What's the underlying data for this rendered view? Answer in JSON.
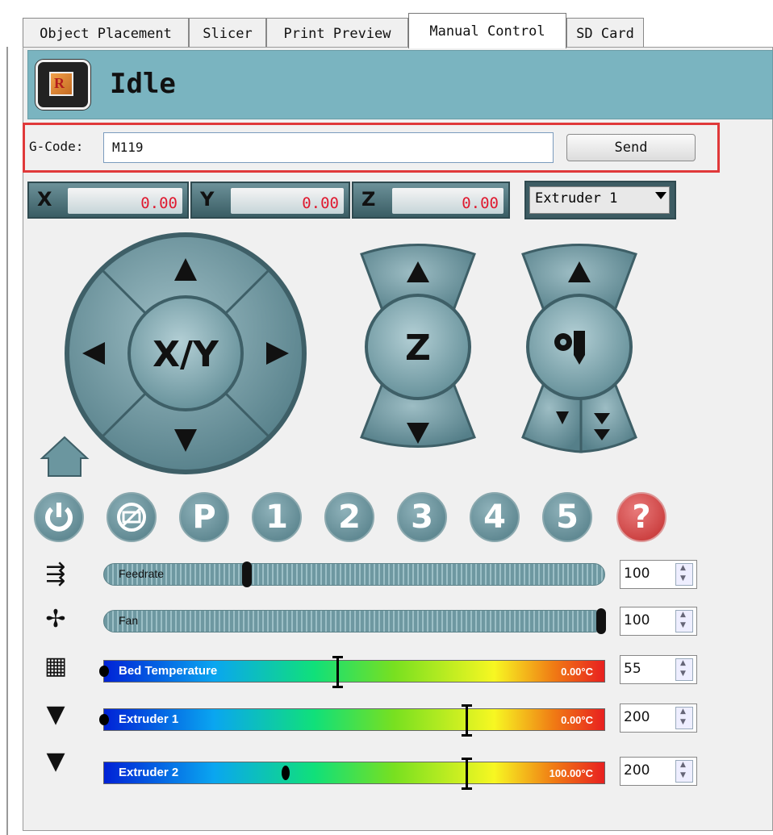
{
  "tabs": [
    {
      "label": "Object Placement"
    },
    {
      "label": "Slicer"
    },
    {
      "label": "Print Preview"
    },
    {
      "label": "Manual Control",
      "active": true
    },
    {
      "label": "SD Card"
    }
  ],
  "status": {
    "text": "Idle",
    "logo_letter": "R"
  },
  "gcode": {
    "label": "G-Code:",
    "value": "M119",
    "send_label": "Send"
  },
  "coords": {
    "x": {
      "label": "X",
      "value": "0.00"
    },
    "y": {
      "label": "Y",
      "value": "0.00"
    },
    "z": {
      "label": "Z",
      "value": "0.00"
    }
  },
  "extruder_select": {
    "value": "Extruder 1"
  },
  "pads": {
    "xy_label": "X/Y",
    "z_label": "Z"
  },
  "buttons": {
    "power_icon": "power-icon",
    "no_gcode_icon": "gcode-disabled-icon",
    "p": "P",
    "b1": "1",
    "b2": "2",
    "b3": "3",
    "b4": "4",
    "b5": "5",
    "help": "?"
  },
  "sliders": {
    "feedrate": {
      "name": "Feedrate",
      "value": "100",
      "level": 0.28
    },
    "fan": {
      "name": "Fan",
      "value": "100",
      "level": 1.0
    }
  },
  "temps": {
    "bed": {
      "name": "Bed Temperature",
      "current": "0.00°C",
      "target": "55"
    },
    "ext1": {
      "name": "Extruder 1",
      "current": "0.00°C",
      "target": "200"
    },
    "ext2": {
      "name": "Extruder 2",
      "current": "100.00°C",
      "target": "200"
    }
  },
  "colors": {
    "status_bar": "#7ab4c0",
    "highlight_border": "#e0393a",
    "coord_value": "#e0192f"
  }
}
